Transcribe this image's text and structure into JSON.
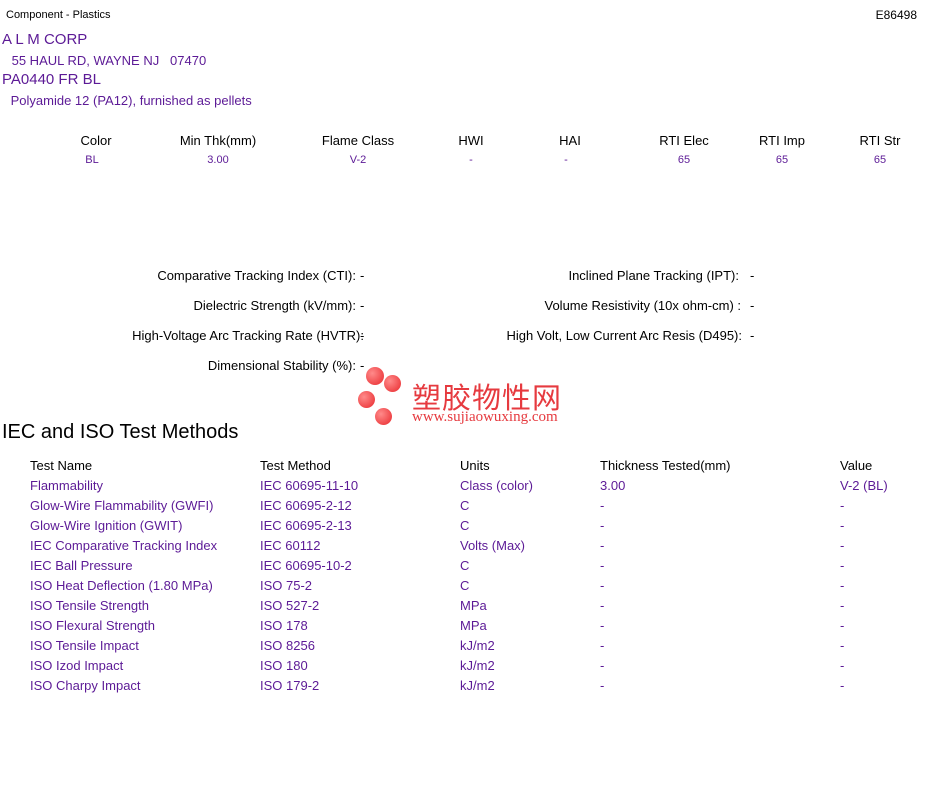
{
  "header": {
    "category": "Component - Plastics",
    "file_number": "E86498",
    "company": "A L M CORP",
    "address": " 55 HAUL RD, WAYNE NJ   07470",
    "product": "PA0440 FR BL",
    "description": " Polyamide 12 (PA12), furnished as pellets"
  },
  "ratings": {
    "columns": [
      {
        "header": "Color",
        "value": "BL"
      },
      {
        "header": "Min Thk(mm)",
        "value": "3.00"
      },
      {
        "header": "Flame Class",
        "value": "V-2"
      },
      {
        "header": "HWI",
        "value": "-"
      },
      {
        "header": "HAI",
        "value": "-"
      },
      {
        "header": "RTI Elec",
        "value": "65"
      },
      {
        "header": "RTI Imp",
        "value": "65"
      },
      {
        "header": "RTI Str",
        "value": "65"
      }
    ]
  },
  "properties": {
    "left": [
      {
        "label": "Comparative Tracking Index (CTI):",
        "value": "-"
      },
      {
        "label": "Dielectric Strength (kV/mm):",
        "value": "-"
      },
      {
        "label": "High-Voltage Arc Tracking Rate (HVTR):",
        "value": "-"
      },
      {
        "label": "Dimensional Stability (%):",
        "value": "-"
      }
    ],
    "right": [
      {
        "label": "Inclined Plane Tracking (IPT):",
        "value": "-"
      },
      {
        "label": "Volume Resistivity (10x ohm-cm) :",
        "value": "-"
      },
      {
        "label": "High Volt, Low Current Arc Resis (D495):",
        "value": "-"
      }
    ]
  },
  "watermark": {
    "text": "塑胶物性网",
    "url": "www.sujiaowuxing.com"
  },
  "test_methods": {
    "title": "IEC and ISO Test Methods",
    "headers": [
      "Test Name",
      "Test Method",
      "Units",
      "Thickness Tested(mm)",
      "Value"
    ],
    "rows": [
      [
        "Flammability",
        "IEC 60695-11-10",
        "Class (color)",
        "3.00",
        "V-2 (BL)"
      ],
      [
        "Glow-Wire Flammability (GWFI)",
        "IEC 60695-2-12",
        "C",
        "-",
        "-"
      ],
      [
        "Glow-Wire Ignition (GWIT)",
        "IEC 60695-2-13",
        "C",
        "-",
        "-"
      ],
      [
        "IEC Comparative Tracking Index",
        "IEC 60112",
        "Volts (Max)",
        "-",
        "-"
      ],
      [
        "IEC Ball Pressure",
        "IEC 60695-10-2",
        "C",
        "-",
        "-"
      ],
      [
        "ISO Heat Deflection (1.80 MPa)",
        "ISO 75-2",
        "C",
        "-",
        "-"
      ],
      [
        "ISO Tensile Strength",
        "ISO 527-2",
        "MPa",
        "-",
        "-"
      ],
      [
        "ISO Flexural Strength",
        "ISO 178",
        "MPa",
        "-",
        "-"
      ],
      [
        "ISO Tensile Impact",
        "ISO 8256",
        "kJ/m2",
        "-",
        "-"
      ],
      [
        "ISO Izod Impact",
        "ISO 180",
        "kJ/m2",
        "-",
        "-"
      ],
      [
        "ISO Charpy Impact",
        "ISO 179-2",
        "kJ/m2",
        "-",
        "-"
      ]
    ]
  },
  "colors": {
    "accent": "#5c1a96",
    "watermark": "#e63a3f"
  }
}
